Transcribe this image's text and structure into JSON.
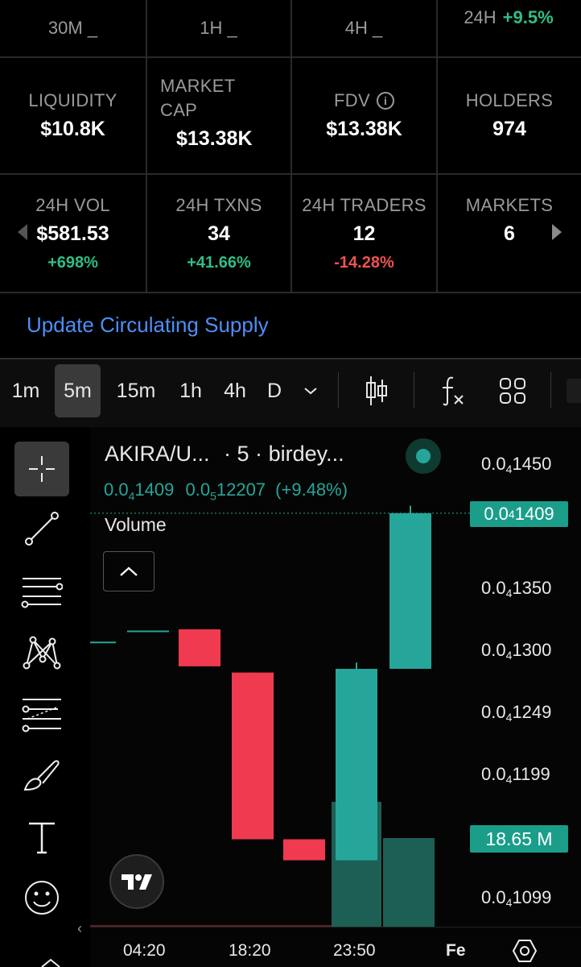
{
  "tabs": [
    {
      "label": "30M _"
    },
    {
      "label": "1H _"
    },
    {
      "label": "4H _"
    },
    {
      "label": "24H",
      "change": "+9.5%"
    }
  ],
  "stats_row1": [
    {
      "label": "LIQUIDITY",
      "value": "$10.8K"
    },
    {
      "label": "MARKET CAP",
      "value": "$13.38K"
    },
    {
      "label": "FDV",
      "value": "$13.38K",
      "icon": "info-icon"
    },
    {
      "label": "HOLDERS",
      "value": "974"
    }
  ],
  "stats_row2": [
    {
      "label": "24H VOL",
      "value": "$581.53",
      "change": "+698%",
      "trend": "up"
    },
    {
      "label": "24H TXNS",
      "value": "34",
      "change": "+41.66%",
      "trend": "up"
    },
    {
      "label": "24H TRADERS",
      "value": "12",
      "change": "-14.28%",
      "trend": "down"
    },
    {
      "label": "MARKETS",
      "value": "6"
    }
  ],
  "update_link": "Update Circulating Supply",
  "toolbar": {
    "intervals": [
      "1m",
      "5m",
      "15m",
      "1h",
      "4h",
      "D"
    ],
    "selected_interval": "5m",
    "icons": [
      "chevron-down-icon",
      "candlestick-icon",
      "function-icon",
      "layout-grid-icon"
    ]
  },
  "chart_header": {
    "symbol": "AKIRA/U...",
    "interval": "· 5 ·",
    "source": "birdey...",
    "price_prefix": "0.0",
    "price_sub": "4",
    "price_rest": "1409",
    "change_prefix": "0.0",
    "change_sub": "5",
    "change_rest": "12207",
    "change_pct": "(+9.48%)",
    "volume_label": "Volume"
  },
  "price_axis": [
    {
      "prefix": "0.0",
      "sub": "4",
      "rest": "1450"
    },
    {
      "prefix": "0.0",
      "sub": "4",
      "rest": "1350"
    },
    {
      "prefix": "0.0",
      "sub": "4",
      "rest": "1300"
    },
    {
      "prefix": "0.0",
      "sub": "4",
      "rest": "1249"
    },
    {
      "prefix": "0.0",
      "sub": "4",
      "rest": "1199"
    },
    {
      "prefix": "0.0",
      "sub": "4",
      "rest": "1099"
    }
  ],
  "current_price_tag": {
    "prefix": "0.0",
    "sub": "4",
    "rest": "1409"
  },
  "volume_tag": "18.65 M",
  "time_axis": [
    "04:20",
    "18:20",
    "23:50",
    "Fe"
  ],
  "colors": {
    "up": "#26a69a",
    "down": "#ef3a4f",
    "accent_link": "#4f8ef7",
    "volume_up": "#1d5f54"
  },
  "chart_data": {
    "type": "candlestick",
    "candles": [
      {
        "open": 1.305e-05,
        "close": 1.305e-05,
        "high": 1.305e-05,
        "low": 1.305e-05,
        "trend": "up"
      },
      {
        "open": 1.314e-05,
        "close": 1.314e-05,
        "high": 1.314e-05,
        "low": 1.314e-05,
        "trend": "up"
      },
      {
        "open": 1.315e-05,
        "close": 1.285e-05,
        "high": 1.315e-05,
        "low": 1.285e-05,
        "trend": "down"
      },
      {
        "open": 1.28e-05,
        "close": 1.145e-05,
        "high": 1.28e-05,
        "low": 1.145e-05,
        "trend": "down"
      },
      {
        "open": 1.145e-05,
        "close": 1.128e-05,
        "high": 1.145e-05,
        "low": 1.128e-05,
        "trend": "down"
      },
      {
        "open": 1.128e-05,
        "close": 1.283e-05,
        "high": 1.288e-05,
        "low": 1.128e-05,
        "trend": "up"
      },
      {
        "open": 1.283e-05,
        "close": 1.409e-05,
        "high": 1.415e-05,
        "low": 1.283e-05,
        "trend": "up"
      }
    ],
    "volume_last": "18.65 M",
    "price_ticks": [
      "0.0₄1450",
      "0.0₄1350",
      "0.0₄1300",
      "0.0₄1249",
      "0.0₄1199",
      "0.0₄1099"
    ],
    "time_ticks": [
      "04:20",
      "18:20",
      "23:50",
      "Fe"
    ]
  }
}
